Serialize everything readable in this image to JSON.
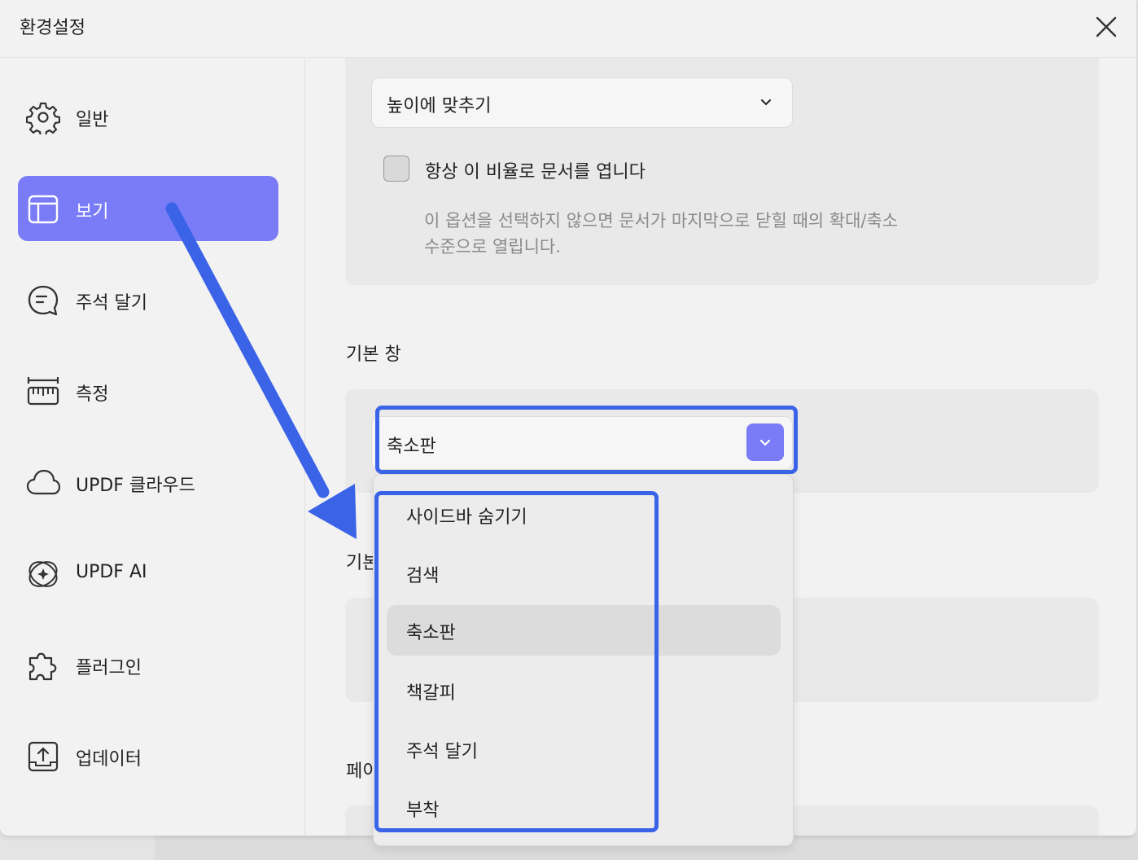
{
  "window": {
    "title": "환경설정"
  },
  "sidebar": {
    "items": [
      {
        "label": "일반",
        "icon": "gear-icon",
        "active": false
      },
      {
        "label": "보기",
        "icon": "layout-icon",
        "active": true
      },
      {
        "label": "주석 달기",
        "icon": "comment-icon",
        "active": false
      },
      {
        "label": "측정",
        "icon": "ruler-icon",
        "active": false
      },
      {
        "label": "UPDF 클라우드",
        "icon": "cloud-icon",
        "active": false
      },
      {
        "label": "UPDF AI",
        "icon": "ai-sparkle-icon",
        "active": false
      },
      {
        "label": "플러그인",
        "icon": "puzzle-icon",
        "active": false
      },
      {
        "label": "업데이터",
        "icon": "upload-icon",
        "active": false
      }
    ]
  },
  "zoom": {
    "select_value": "높이에 맞추기",
    "checkbox_label": "항상 이 비율로 문서를 엽니다",
    "checkbox_checked": false,
    "helper_line1": "이 옵션을 선택하지 않으면 문서가 마지막으로 닫힐 때의 확대/축소",
    "helper_line2": "수준으로 열립니다."
  },
  "default_pane": {
    "title": "기본 창",
    "select_value": "축소판",
    "options": [
      "사이드바 숨기기",
      "검색",
      "축소판",
      "책갈피",
      "주석 달기",
      "부착"
    ],
    "selected_index": 2
  },
  "hidden_sections": {
    "partial_title_1": "기본",
    "partial_title_2": "페이"
  },
  "colors": {
    "accent": "#7a7cf7",
    "annotation": "#3a63e8",
    "background": "#f2f2f2",
    "panel": "#e9e9e9"
  }
}
